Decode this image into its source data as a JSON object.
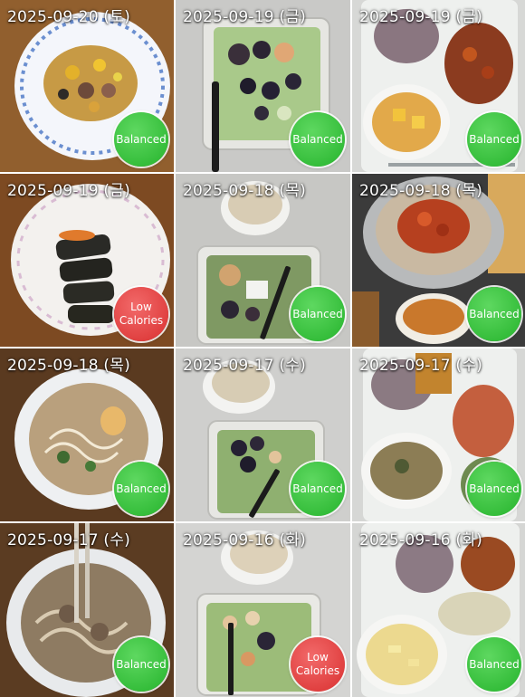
{
  "meals": [
    {
      "date": "2025-09-20 (토)",
      "badge": "Balanced",
      "status": "balanced",
      "icon": "meal-photo-rice-bowl"
    },
    {
      "date": "2025-09-19 (금)",
      "badge": "Balanced",
      "status": "balanced",
      "icon": "meal-photo-salad"
    },
    {
      "date": "2025-09-19 (금)",
      "badge": "Balanced",
      "status": "balanced",
      "icon": "meal-photo-tray"
    },
    {
      "date": "2025-09-19 (금)",
      "badge": "Low\nCalories",
      "status": "low",
      "icon": "meal-photo-kimbap"
    },
    {
      "date": "2025-09-18 (목)",
      "badge": "Balanced",
      "status": "balanced",
      "icon": "meal-photo-salad"
    },
    {
      "date": "2025-09-18 (목)",
      "badge": "Balanced",
      "status": "balanced",
      "icon": "meal-photo-bibimbap"
    },
    {
      "date": "2025-09-18 (목)",
      "badge": "Balanced",
      "status": "balanced",
      "icon": "meal-photo-noodle-soup"
    },
    {
      "date": "2025-09-17 (수)",
      "badge": "Balanced",
      "status": "balanced",
      "icon": "meal-photo-salad"
    },
    {
      "date": "2025-09-17 (수)",
      "badge": "Balanced",
      "status": "balanced",
      "icon": "meal-photo-tray"
    },
    {
      "date": "2025-09-17 (수)",
      "badge": "Balanced",
      "status": "balanced",
      "icon": "meal-photo-noodle-soup"
    },
    {
      "date": "2025-09-16 (화)",
      "badge": "Low\nCalories",
      "status": "low",
      "icon": "meal-photo-salad"
    },
    {
      "date": "2025-09-16 (화)",
      "badge": "Balanced",
      "status": "balanced",
      "icon": "meal-photo-tray"
    }
  ],
  "colors": {
    "balanced": "#2db935",
    "low": "#e03a3a",
    "date_text": "#ffffff"
  }
}
